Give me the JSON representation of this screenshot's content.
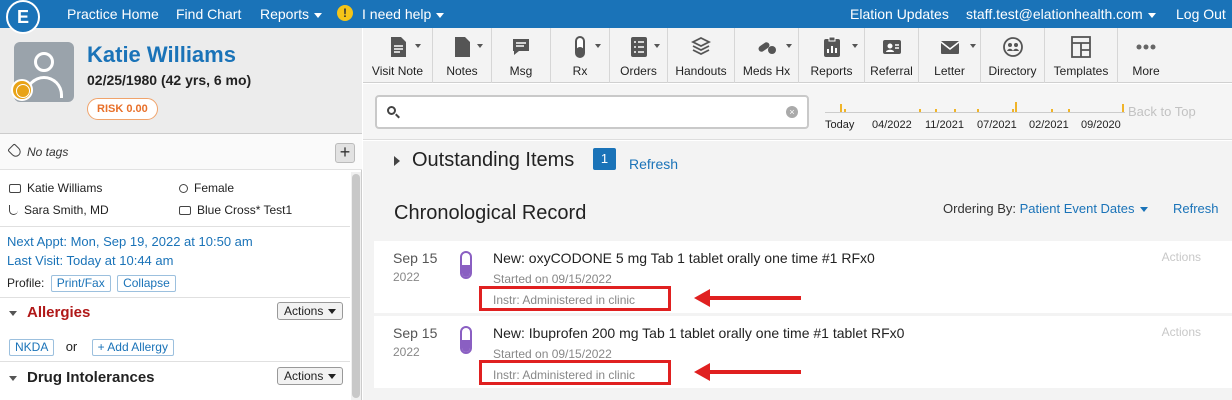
{
  "topnav": {
    "logo": "E",
    "practice_home": "Practice Home",
    "find_chart": "Find Chart",
    "reports": "Reports",
    "help_icon": "!",
    "help": "I need help",
    "updates": "Elation Updates",
    "user_email": "staff.test@elationhealth.com",
    "logout": "Log Out"
  },
  "patient": {
    "name": "Katie Williams",
    "dob": "02/25/1980 (42 yrs, 6 mo)",
    "risk": "RISK 0.00",
    "tags": "No tags",
    "plus": "+",
    "info_name": "Katie Williams",
    "gender": "Female",
    "provider": "Sara Smith, MD",
    "insurance": "Blue Cross* Test1",
    "next_appt": "Next Appt: Mon, Sep 19, 2022 at 10:50 am",
    "last_visit": "Last Visit: Today at 10:44 am",
    "profile_label": "Profile:",
    "print_fax": "Print/Fax",
    "collapse": "Collapse"
  },
  "sections": {
    "allergies_title": "Allergies",
    "allergies_actions": "Actions",
    "nkda": "NKDA",
    "or_text": "or",
    "add_allergy": "+ Add Allergy",
    "intolerances_title": "Drug Intolerances",
    "intolerances_actions": "Actions"
  },
  "toolbar": {
    "items": [
      {
        "label": "Visit Note",
        "icon": "document-icon"
      },
      {
        "label": "Notes",
        "icon": "note-icon"
      },
      {
        "label": "Msg",
        "icon": "message-icon"
      },
      {
        "label": "Rx",
        "icon": "pill-icon"
      },
      {
        "label": "Orders",
        "icon": "orders-icon"
      },
      {
        "label": "Handouts",
        "icon": "stack-icon"
      },
      {
        "label": "Meds Hx",
        "icon": "pills-icon"
      },
      {
        "label": "Reports",
        "icon": "clipboard-icon"
      },
      {
        "label": "Referral",
        "icon": "referral-icon"
      },
      {
        "label": "Letter",
        "icon": "envelope-icon"
      },
      {
        "label": "Directory",
        "icon": "people-icon"
      },
      {
        "label": "Templates",
        "icon": "templates-icon"
      },
      {
        "label": "More",
        "icon": "dots-icon"
      }
    ]
  },
  "search": {
    "placeholder": "",
    "clear": "×"
  },
  "timeline": {
    "labels": [
      "Today",
      "04/2022",
      "11/2021",
      "07/2021",
      "02/2021",
      "09/2020"
    ],
    "back_to_top": "Back to Top"
  },
  "outstanding": {
    "title": "Outstanding Items",
    "count": "1",
    "refresh": "Refresh"
  },
  "chronological": {
    "title": "Chronological Record",
    "ordering_label": "Ordering By:",
    "ordering_value": "Patient Event Dates",
    "refresh": "Refresh",
    "records": [
      {
        "date": "Sep 15",
        "year": "2022",
        "title": "New: oxyCODONE 5 mg Tab 1 tablet orally one time #1 RFx0",
        "started": "Started on 09/15/2022",
        "instr": "Instr: Administered in clinic",
        "actions": "Actions"
      },
      {
        "date": "Sep 15",
        "year": "2022",
        "title": "New: Ibuprofen 200 mg Tab 1 tablet orally one time #1 tablet RFx0",
        "started": "Started on 09/15/2022",
        "instr": "Instr: Administered in clinic",
        "actions": "Actions"
      }
    ]
  },
  "colors": {
    "brand_blue": "#1a73b8",
    "highlight_red": "#e02020",
    "timeline_tick": "#f0b429",
    "pill_purple": "#8a5fc2"
  }
}
